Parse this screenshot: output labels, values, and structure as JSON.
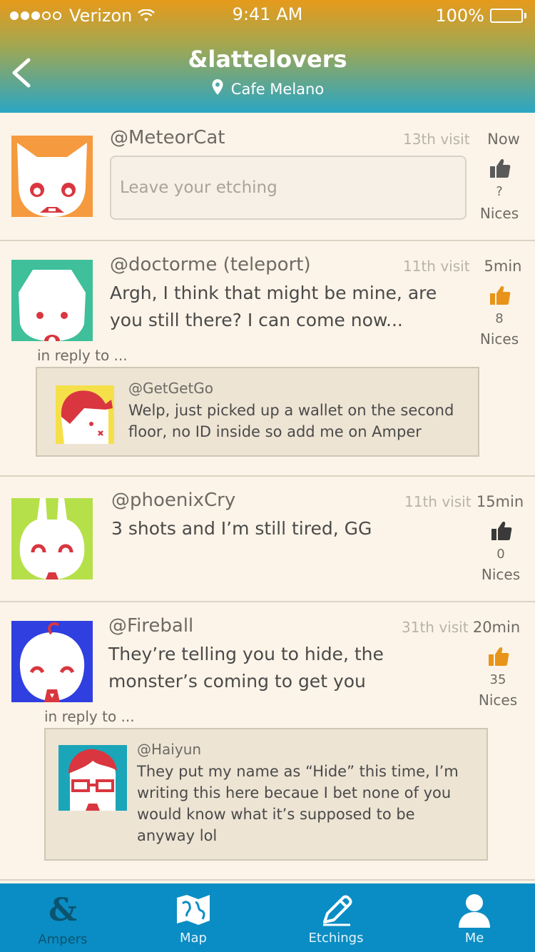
{
  "status_bar": {
    "carrier": "Verizon",
    "time": "9:41 AM",
    "battery": "100%",
    "battery_level": 1.0
  },
  "nav": {
    "title": "&lattelovers",
    "location": "Cafe Melano"
  },
  "compose": {
    "handle": "@MeteorCat",
    "visit": "13th visit",
    "time": "Now",
    "placeholder": "Leave your etching",
    "nice_count": "?",
    "nice_label": "Nices"
  },
  "posts": [
    {
      "handle": "@doctorme (teleport)",
      "visit": "11th visit",
      "time": "5min",
      "text_lines": [
        "Argh, I think that might be mine, are",
        "you still there? I can come now..."
      ],
      "nice_count": "8",
      "nice_label": "Nices",
      "liked": true,
      "reply_label": "in reply to ...",
      "reply": {
        "handle": "@GetGetGo",
        "text_lines": [
          "Welp, just picked up a wallet on the second",
          "floor, no ID inside so add me on Amper"
        ]
      }
    },
    {
      "handle": "@phoenixCry",
      "visit": "11th visit",
      "time": "15min",
      "text_lines": [
        "3 shots and I’m still tired, GG"
      ],
      "nice_count": "0",
      "nice_label": "Nices",
      "liked": false
    },
    {
      "handle": "@Fireball",
      "visit": "31th visit",
      "time": "20min",
      "text_lines": [
        "They’re telling you to hide, the",
        "monster’s coming to get you"
      ],
      "nice_count": "35",
      "nice_label": "Nices",
      "liked": true,
      "reply_label": "in reply to ...",
      "reply": {
        "handle": "@Haiyun",
        "text_lines": [
          "They put my name as “Hide” this time, I’m",
          "writing this here becaue I bet none of you",
          "would know what it’s supposed to be",
          "anyway lol"
        ]
      }
    }
  ],
  "tabs": [
    {
      "label": "Ampers",
      "icon": "ampersand-icon",
      "active": true
    },
    {
      "label": "Map",
      "icon": "map-icon",
      "active": false
    },
    {
      "label": "Etchings",
      "icon": "pencil-icon",
      "active": false
    },
    {
      "label": "Me",
      "icon": "person-icon",
      "active": false
    }
  ],
  "colors": {
    "header_top": "#e79a1b",
    "header_bottom": "#2aa6c4",
    "tabbar": "#0a8dc4",
    "liked_thumb": "#e8941a",
    "neutral_thumb": "#5a5a5a",
    "background": "#fcf4e8"
  }
}
